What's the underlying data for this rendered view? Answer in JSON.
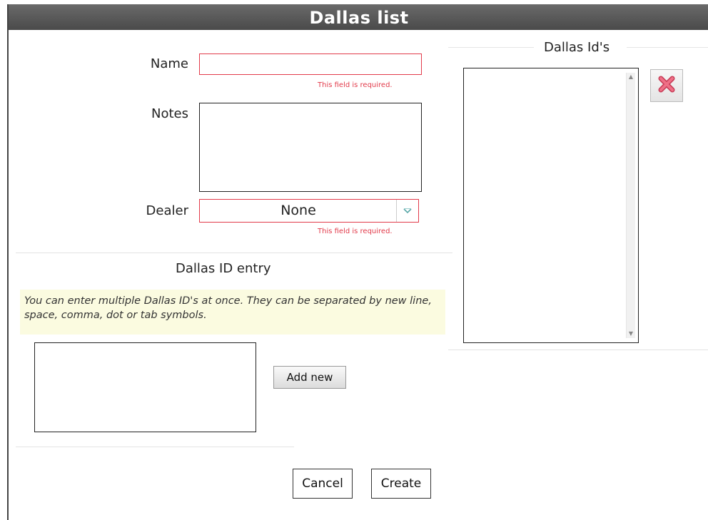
{
  "window": {
    "title": "Dallas list"
  },
  "form": {
    "name_label": "Name",
    "name_value": "",
    "name_error": "This field is required.",
    "notes_label": "Notes",
    "notes_value": "",
    "dealer_label": "Dealer",
    "dealer_value": "None",
    "dealer_error": "This field is required."
  },
  "entry": {
    "title": "Dallas ID entry",
    "hint": "You can enter multiple Dallas ID's at once. They can be separated by new line, space, comma, dot or tab symbols.",
    "textarea_value": "",
    "add_label": "Add new"
  },
  "ids_panel": {
    "title": "Dallas Id's"
  },
  "actions": {
    "cancel_label": "Cancel",
    "create_label": "Create"
  },
  "icons": {
    "delete": "close-x-icon",
    "dropdown": "chevron-down-icon"
  },
  "colors": {
    "error": "#e23a4a",
    "title_bar": "#4a4a4a",
    "hint_bg": "#fbfbe0",
    "delete_icon": "#e0506a"
  }
}
